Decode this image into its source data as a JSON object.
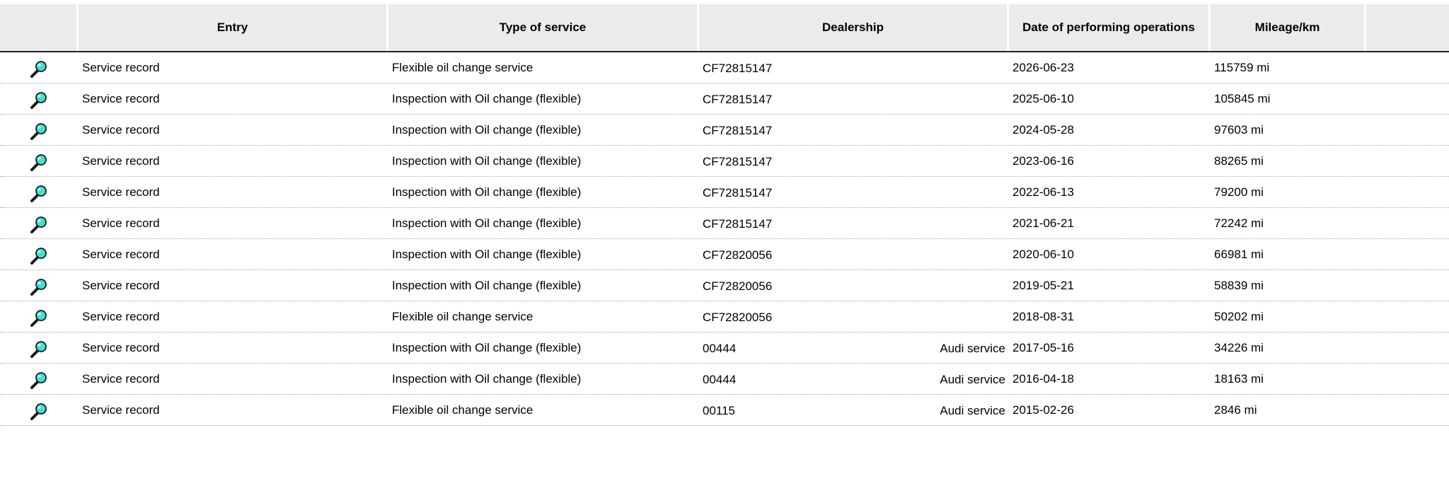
{
  "table": {
    "columns": [
      "",
      "Entry",
      "Type of service",
      "Dealership",
      "Date of performing operations",
      "Mileage/km",
      ""
    ],
    "rows": [
      {
        "icon": "magnifier-icon",
        "entry": "Service record",
        "type": "Flexible oil change service",
        "dealer_code": "CF72815147",
        "dealer_name": "",
        "date": "2026-06-23",
        "mileage": "115759 mi"
      },
      {
        "icon": "magnifier-icon",
        "entry": "Service record",
        "type": "Inspection with Oil change (flexible)",
        "dealer_code": "CF72815147",
        "dealer_name": "",
        "date": "2025-06-10",
        "mileage": "105845 mi"
      },
      {
        "icon": "magnifier-icon",
        "entry": "Service record",
        "type": "Inspection with Oil change (flexible)",
        "dealer_code": "CF72815147",
        "dealer_name": "",
        "date": "2024-05-28",
        "mileage": "97603 mi"
      },
      {
        "icon": "magnifier-icon",
        "entry": "Service record",
        "type": "Inspection with Oil change (flexible)",
        "dealer_code": "CF72815147",
        "dealer_name": "",
        "date": "2023-06-16",
        "mileage": "88265 mi"
      },
      {
        "icon": "magnifier-icon",
        "entry": "Service record",
        "type": "Inspection with Oil change (flexible)",
        "dealer_code": "CF72815147",
        "dealer_name": "",
        "date": "2022-06-13",
        "mileage": "79200 mi"
      },
      {
        "icon": "magnifier-icon",
        "entry": "Service record",
        "type": "Inspection with Oil change (flexible)",
        "dealer_code": "CF72815147",
        "dealer_name": "",
        "date": "2021-06-21",
        "mileage": "72242 mi"
      },
      {
        "icon": "magnifier-icon",
        "entry": "Service record",
        "type": "Inspection with Oil change (flexible)",
        "dealer_code": "CF72820056",
        "dealer_name": "",
        "date": "2020-06-10",
        "mileage": "66981 mi"
      },
      {
        "icon": "magnifier-icon",
        "entry": "Service record",
        "type": "Inspection with Oil change (flexible)",
        "dealer_code": "CF72820056",
        "dealer_name": "",
        "date": "2019-05-21",
        "mileage": "58839 mi"
      },
      {
        "icon": "magnifier-icon",
        "entry": "Service record",
        "type": "Flexible oil change service",
        "dealer_code": "CF72820056",
        "dealer_name": "",
        "date": "2018-08-31",
        "mileage": "50202 mi"
      },
      {
        "icon": "magnifier-icon",
        "entry": "Service record",
        "type": "Inspection with Oil change (flexible)",
        "dealer_code": "00444",
        "dealer_name": "Audi service",
        "date": "2017-05-16",
        "mileage": "34226 mi"
      },
      {
        "icon": "magnifier-icon",
        "entry": "Service record",
        "type": "Inspection with Oil change (flexible)",
        "dealer_code": "00444",
        "dealer_name": "Audi service",
        "date": "2016-04-18",
        "mileage": "18163 mi"
      },
      {
        "icon": "magnifier-icon",
        "entry": "Service record",
        "type": "Flexible oil change service",
        "dealer_code": "00115",
        "dealer_name": "Audi service",
        "date": "2015-02-26",
        "mileage": "2846 mi"
      }
    ]
  },
  "colors": {
    "header_bg": "#ebebeb",
    "icon_lens": "#40e0d0"
  }
}
